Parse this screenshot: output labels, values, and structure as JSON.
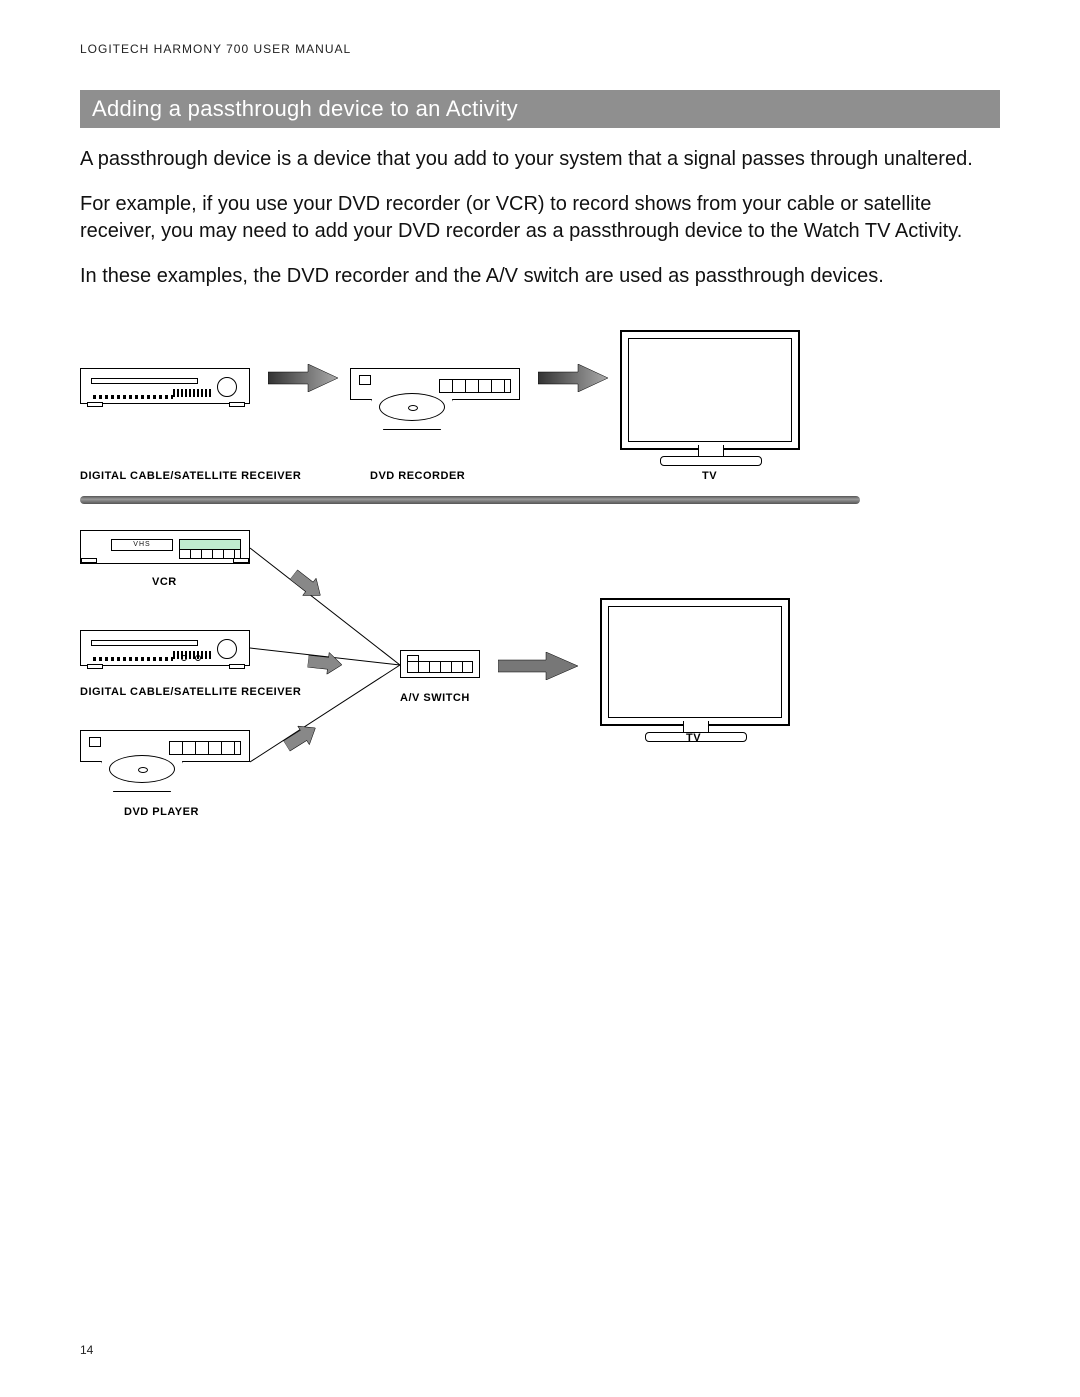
{
  "header": {
    "doc_title": "LOGITECH HARMONY 700 USER MANUAL"
  },
  "section": {
    "title": "Adding a passthrough device to an Activity"
  },
  "paragraphs": {
    "p1": "A passthrough device is a device that you add to your system that a signal passes through unaltered.",
    "p2": "For example, if you use your DVD recorder (or VCR) to record shows from your cable or satellite receiver, you may need to add your DVD recorder as a passthrough device to the Watch TV Activity.",
    "p3": "In these examples, the DVD recorder and the A/V switch are used as passthrough devices."
  },
  "diagram": {
    "top": {
      "receiver_label": "DIGITAL CABLE/SATELLITE RECEIVER",
      "dvd_label": "DVD RECORDER",
      "tv_label": "TV"
    },
    "bottom": {
      "vcr_label": "VCR",
      "vcr_tape_text": "VHS",
      "receiver_label": "DIGITAL CABLE/SATELLITE RECEIVER",
      "dvd_player_label": "DVD PLAYER",
      "av_switch_label": "A/V SWITCH",
      "tv_label": "TV"
    }
  },
  "footer": {
    "page_number": "14"
  }
}
